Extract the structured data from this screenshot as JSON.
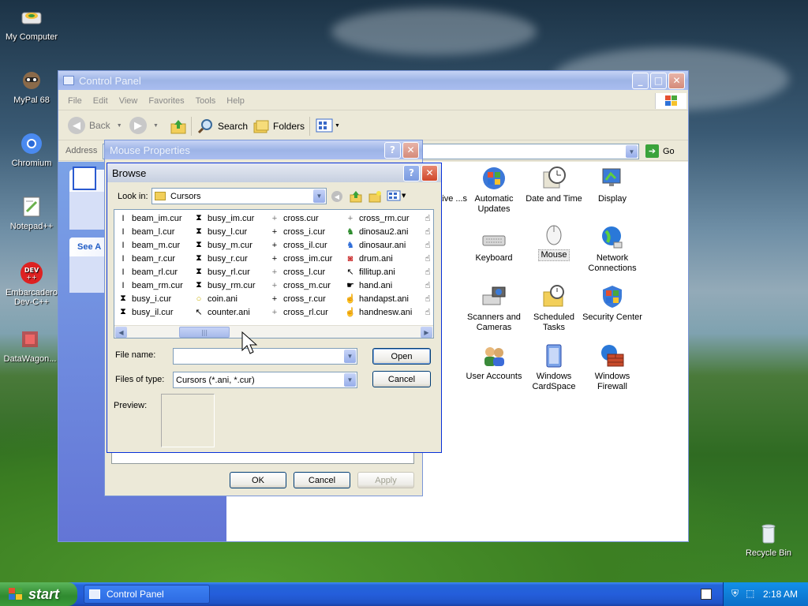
{
  "desktop": {
    "icons": [
      "My Computer",
      "MyPal 68",
      "Chromium",
      "Notepad++",
      "Embarcadero Dev-C++",
      "DataWagon...",
      "Recycle Bin"
    ]
  },
  "control_panel": {
    "title": "Control Panel",
    "menu": [
      "File",
      "Edit",
      "View",
      "Favorites",
      "Tools",
      "Help"
    ],
    "toolbar": {
      "back": "Back",
      "search": "Search",
      "folders": "Folders"
    },
    "address_label": "Address",
    "go_label": "Go",
    "see_also": "See A",
    "items": [
      {
        "label": "...ative ...s"
      },
      {
        "label": "Automatic Updates"
      },
      {
        "label": "Date and Time"
      },
      {
        "label": "Display"
      },
      {
        "label": "Keyboard"
      },
      {
        "label": "Mouse"
      },
      {
        "label": "Network Connections"
      },
      {
        "label": "Scanners and Cameras"
      },
      {
        "label": "Scheduled Tasks"
      },
      {
        "label": "Security Center"
      },
      {
        "label": "User Accounts"
      },
      {
        "label": "Windows CardSpace"
      },
      {
        "label": "Windows Firewall"
      }
    ]
  },
  "mouse_properties": {
    "title": "Mouse Properties",
    "ok": "OK",
    "cancel": "Cancel",
    "apply": "Apply"
  },
  "browse": {
    "title": "Browse",
    "look_in_label": "Look in:",
    "look_in_value": "Cursors",
    "files": [
      [
        "beam_im.cur",
        "beam_l.cur",
        "beam_m.cur",
        "beam_r.cur",
        "beam_rl.cur",
        "beam_rm.cur",
        "busy_i.cur",
        "busy_il.cur"
      ],
      [
        "busy_im.cur",
        "busy_l.cur",
        "busy_m.cur",
        "busy_r.cur",
        "busy_rl.cur",
        "busy_rm.cur",
        "coin.ani",
        "counter.ani"
      ],
      [
        "cross.cur",
        "cross_i.cur",
        "cross_il.cur",
        "cross_im.cur",
        "cross_l.cur",
        "cross_m.cur",
        "cross_r.cur",
        "cross_rl.cur"
      ],
      [
        "cross_rm.cur",
        "dinosau2.ani",
        "dinosaur.ani",
        "drum.ani",
        "fillitup.ani",
        "hand.ani",
        "handapst.ani",
        "handnesw.ani"
      ]
    ],
    "file_name_label": "File name:",
    "file_name_value": "",
    "files_of_type_label": "Files of type:",
    "files_of_type_value": "Cursors (*.ani, *.cur)",
    "preview_label": "Preview:",
    "open": "Open",
    "cancel": "Cancel"
  },
  "taskbar": {
    "start": "start",
    "task": "Control Panel",
    "clock": "2:18 AM"
  }
}
